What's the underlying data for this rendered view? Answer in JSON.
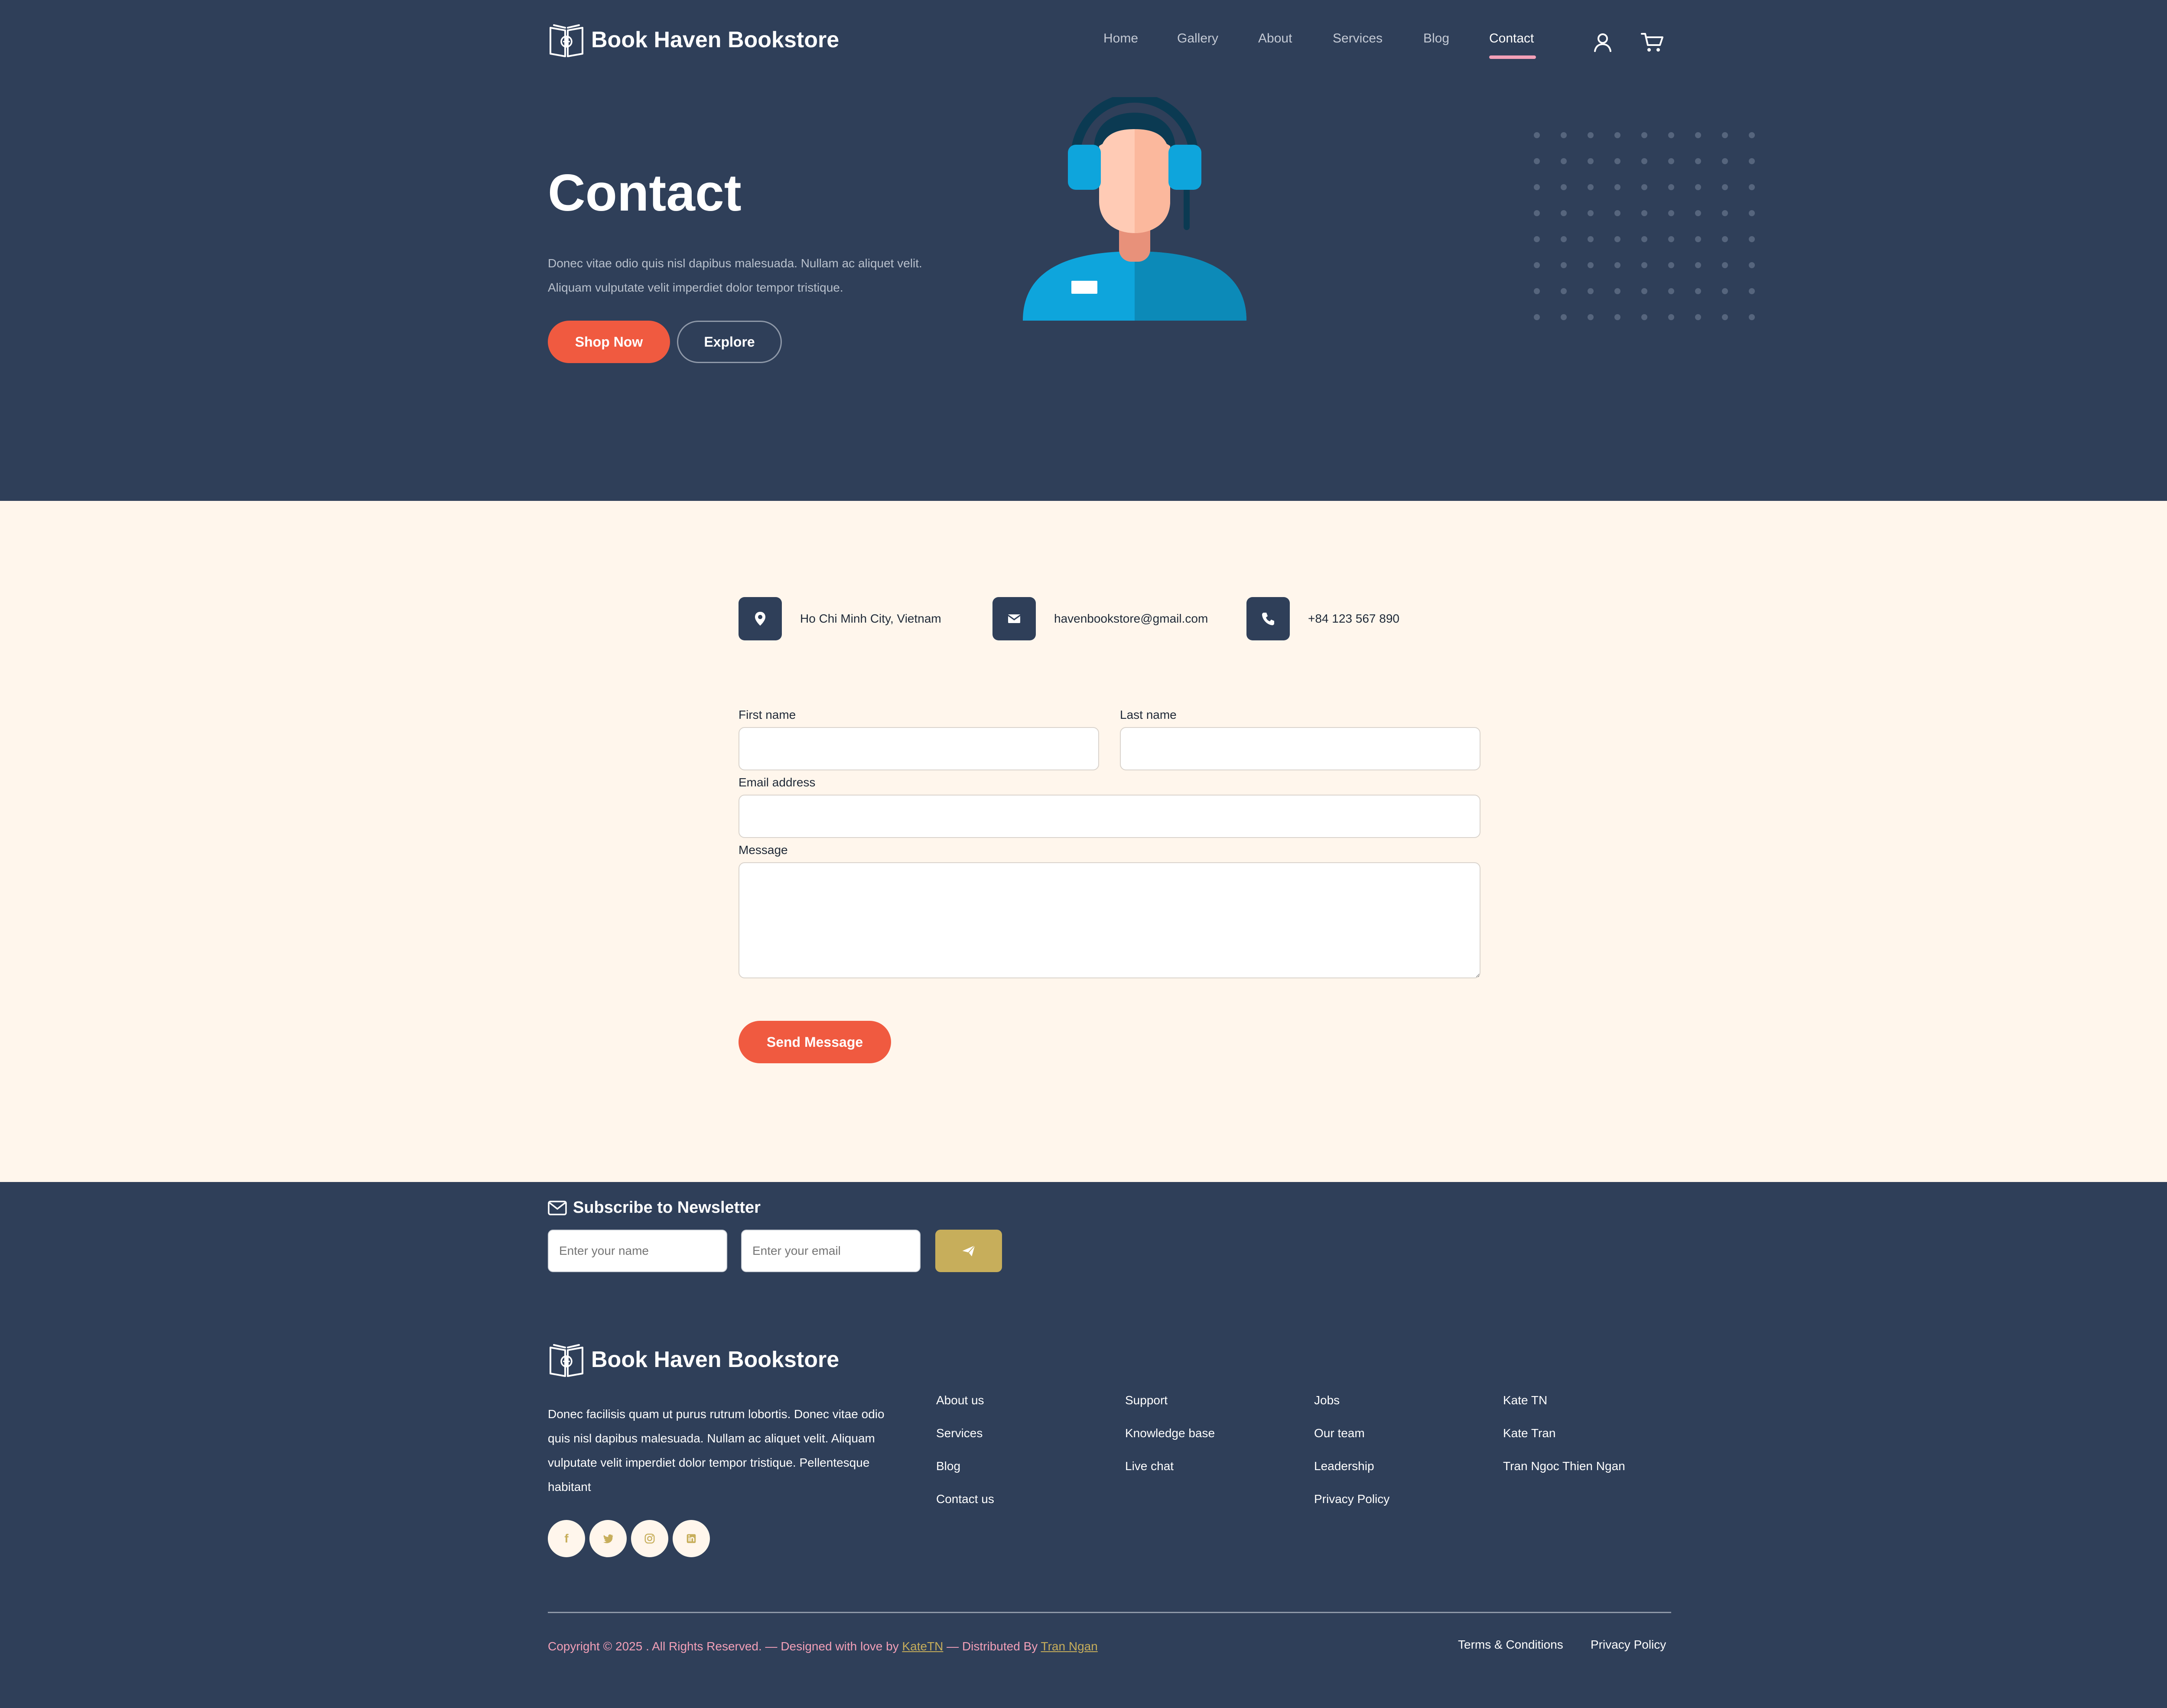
{
  "brand": {
    "name": "Book Haven Bookstore"
  },
  "nav": {
    "items": [
      "Home",
      "Gallery",
      "About",
      "Services",
      "Blog",
      "Contact"
    ],
    "active": "Contact",
    "icons": [
      "user-icon",
      "cart-icon"
    ]
  },
  "hero": {
    "title": "Contact",
    "description": "Donec vitae odio quis nisl dapibus malesuada. Nullam ac aliquet velit. Aliquam vulputate velit imperdiet dolor tempor tristique.",
    "primary_button": "Shop Now",
    "secondary_button": "Explore"
  },
  "contact_info": [
    {
      "icon": "location-pin-icon",
      "text": "Ho Chi Minh City, Vietnam"
    },
    {
      "icon": "envelope-icon",
      "text": "havenbookstore@gmail.com"
    },
    {
      "icon": "phone-icon",
      "text": "+84 123 567 890"
    }
  ],
  "form": {
    "first_name_label": "First name",
    "last_name_label": "Last name",
    "email_label": "Email address",
    "message_label": "Message",
    "submit_label": "Send Message",
    "first_name_value": "",
    "last_name_value": "",
    "email_value": "",
    "message_value": ""
  },
  "newsletter": {
    "title": "Subscribe to Newsletter",
    "name_placeholder": "Enter your name",
    "email_placeholder": "Enter your email",
    "send_icon": "paper-plane-icon"
  },
  "footer": {
    "brand": "Book Haven Bookstore",
    "description": "Donec facilisis quam ut purus rutrum lobortis. Donec vitae odio quis nisl dapibus malesuada. Nullam ac aliquet velit. Aliquam vulputate velit imperdiet dolor tempor tristique. Pellentesque habitant",
    "social": [
      "facebook-icon",
      "twitter-icon",
      "instagram-icon",
      "linkedin-icon"
    ],
    "columns": [
      [
        "About us",
        "Services",
        "Blog",
        "Contact us"
      ],
      [
        "Support",
        "Knowledge base",
        "Live chat"
      ],
      [
        "Jobs",
        "Our team",
        "Leadership",
        "Privacy Policy"
      ],
      [
        "Kate TN",
        "Kate Tran",
        "Tran Ngoc Thien Ngan"
      ]
    ],
    "copyright_prefix": "Copyright © 2025 . All Rights Reserved. — Designed with love by ",
    "designer": "KateTN",
    "distributed_text": " — Distributed By ",
    "distributor": "Tran Ngan",
    "legal_links": [
      "Terms & Conditions",
      "Privacy Policy"
    ]
  },
  "colors": {
    "navy": "#2f3f59",
    "cream": "#fff6ec",
    "accent": "#f05a40",
    "gold": "#c7ae5b",
    "pink": "#f3a0b8"
  }
}
